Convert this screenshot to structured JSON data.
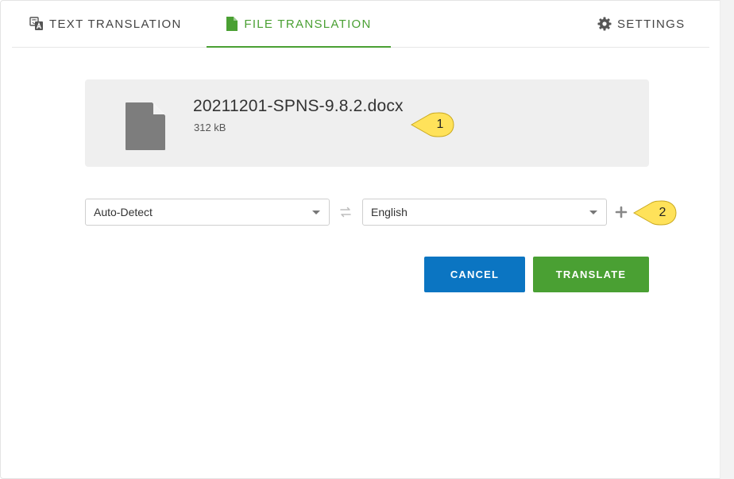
{
  "tabs": {
    "text_translation": "TEXT TRANSLATION",
    "file_translation": "FILE TRANSLATION",
    "settings": "SETTINGS"
  },
  "file": {
    "name": "20211201-SPNS-9.8.2.docx",
    "size": "312 kB"
  },
  "languages": {
    "source": "Auto-Detect",
    "target": "English"
  },
  "buttons": {
    "cancel": "CANCEL",
    "translate": "TRANSLATE"
  },
  "callouts": {
    "first": "1",
    "second": "2"
  },
  "icons": {
    "text_translation": "translate-icon",
    "file_translation": "file-icon",
    "settings": "gear-icon",
    "swap": "swap-icon",
    "add": "plus-icon",
    "document": "document-icon"
  },
  "colors": {
    "active_tab": "#4aa033",
    "cancel_button": "#0b75c2",
    "translate_button": "#4aa033",
    "file_card_background": "#efefef",
    "callout": "#ffe25a"
  }
}
